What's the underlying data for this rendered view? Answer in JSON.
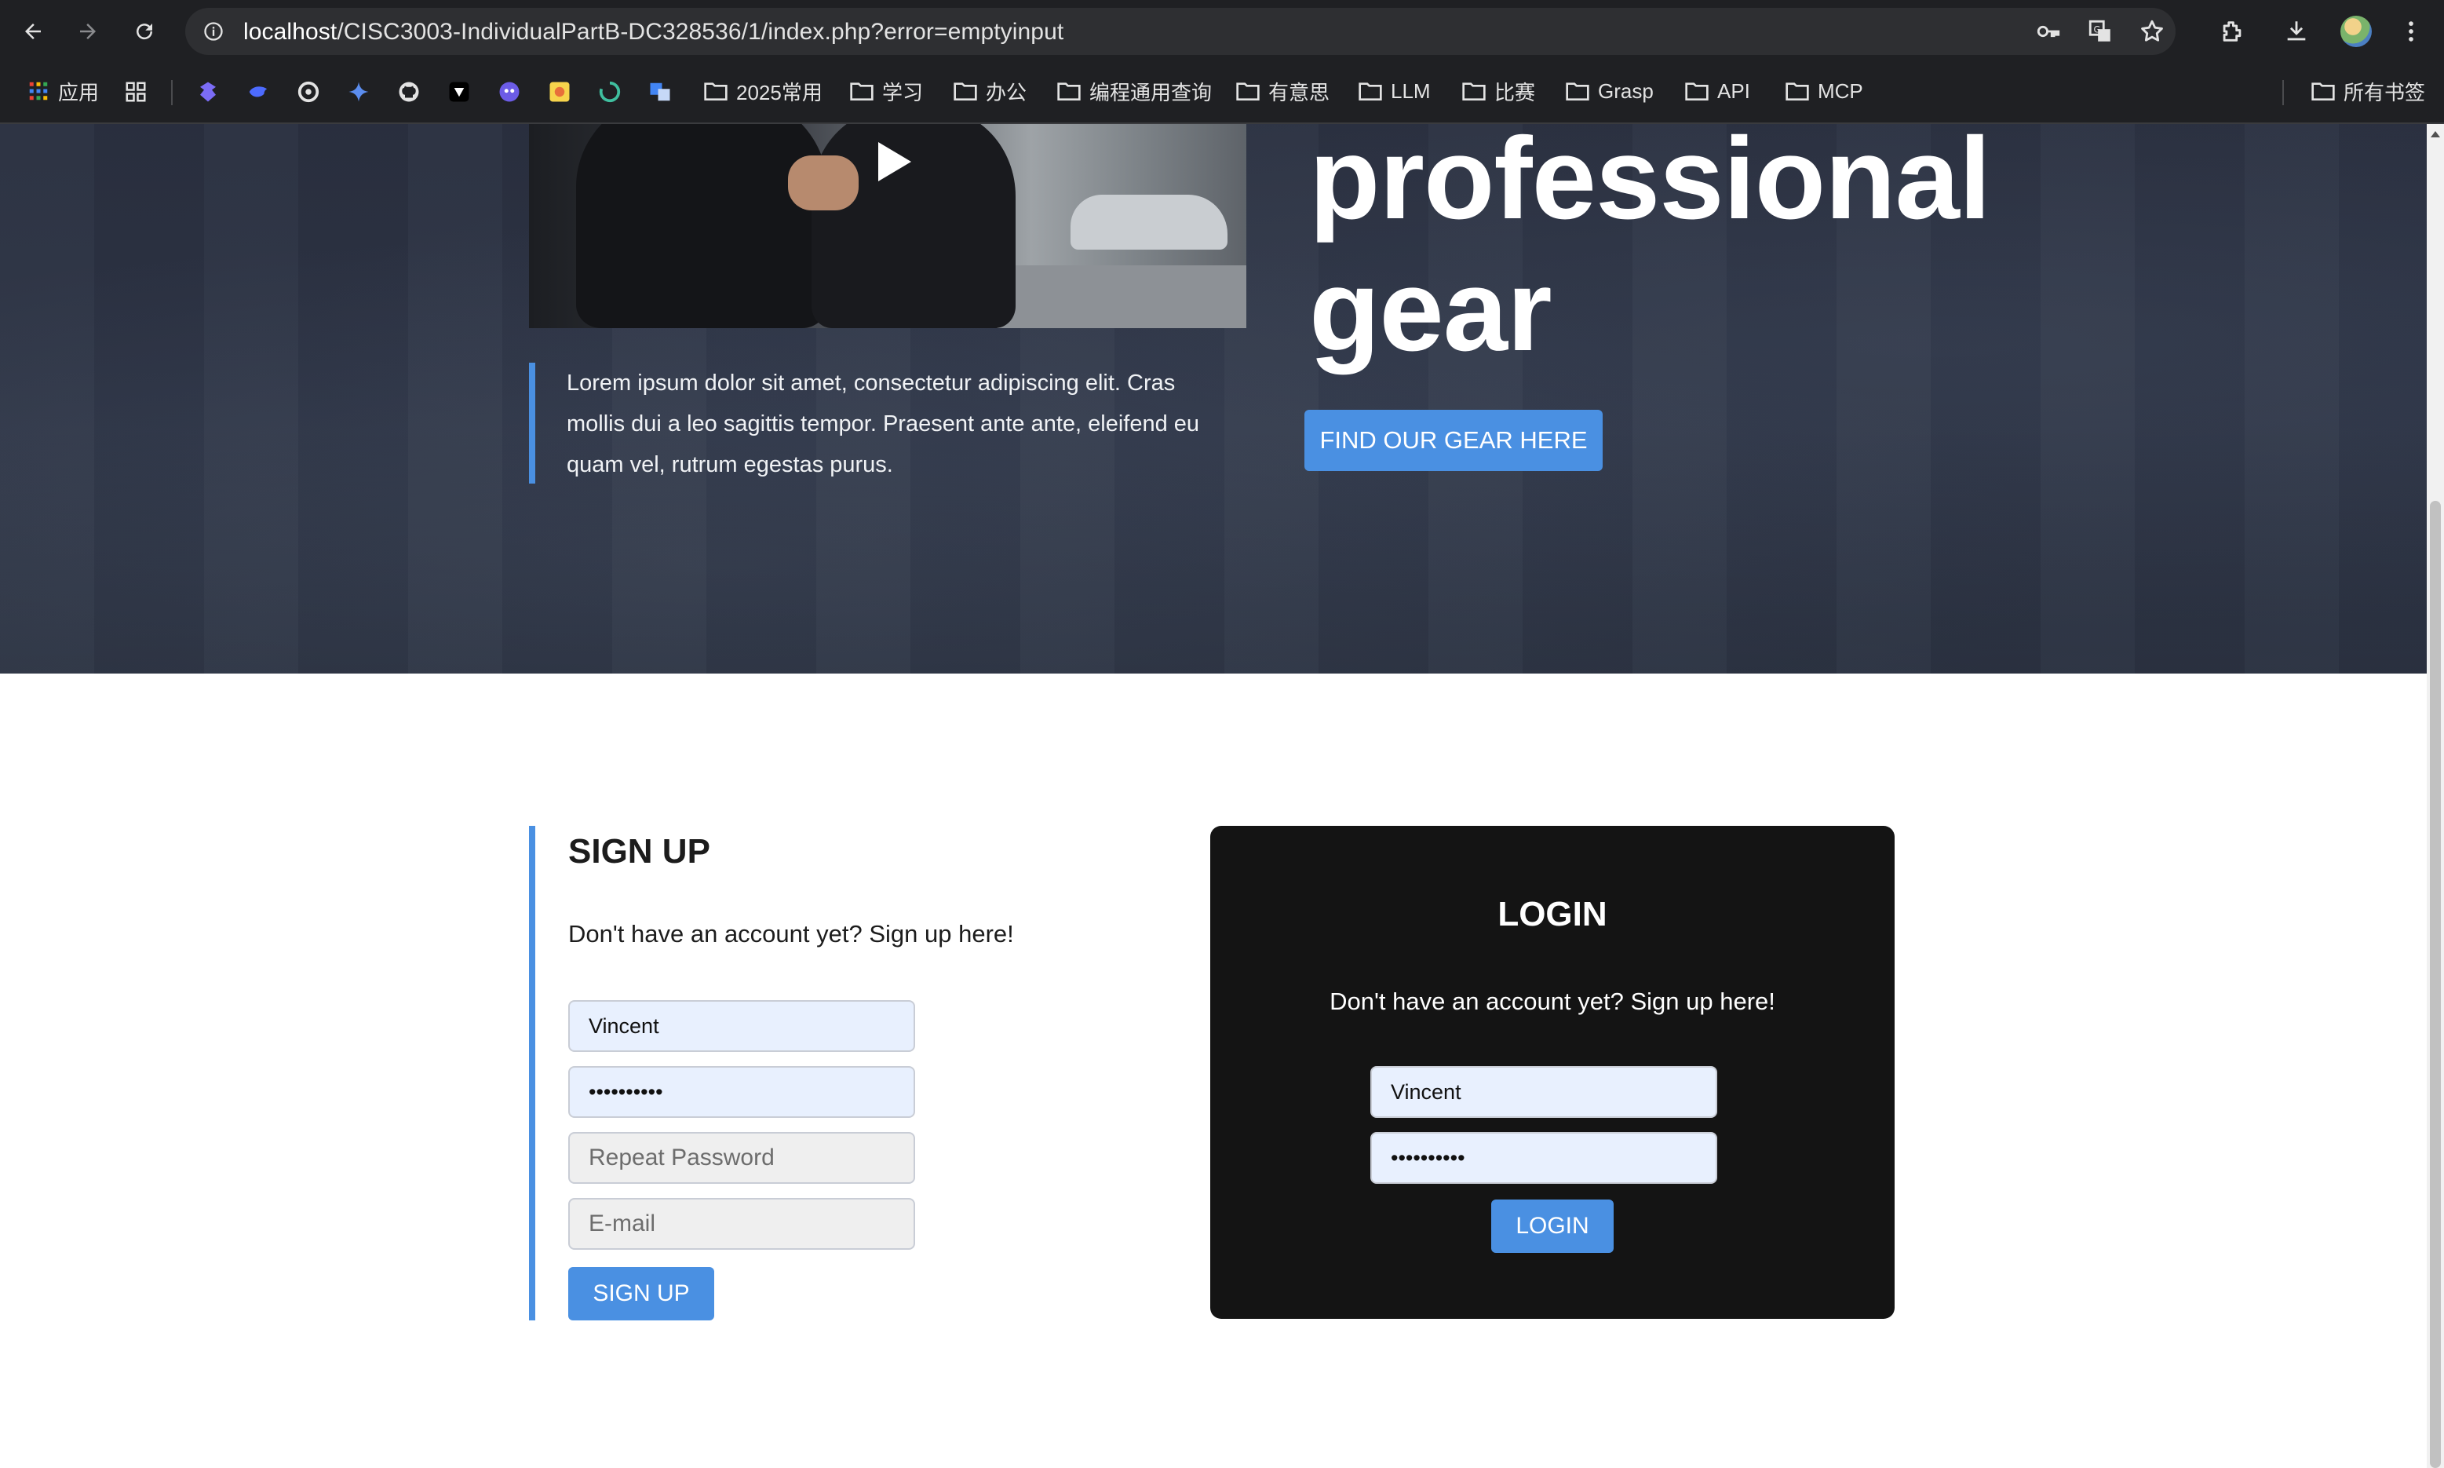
{
  "browser": {
    "url_host": "localhost",
    "url_path": "/CISC3003-IndividualPartB-DC328536/1/index.php?error=emptyinput",
    "icons": [
      "back-icon",
      "forward-icon",
      "reload-icon",
      "site-info-icon",
      "password-key-icon",
      "translate-icon",
      "bookmark-star-icon",
      "extensions-icon",
      "downloads-icon",
      "profile-avatar",
      "menu-icon"
    ]
  },
  "bookmarks": {
    "apps_label": "应用",
    "folders": [
      "2025常用",
      "学习",
      "办公",
      "编程通用查询",
      "有意思",
      "LLM",
      "比赛",
      "Grasp",
      "API",
      "MCP"
    ],
    "all_bookmarks_label": "所有书签"
  },
  "hero": {
    "title": "professional\ngear",
    "quote": "Lorem ipsum dolor sit amet, consectetur adipiscing elit. Cras mollis dui a leo sagittis tempor. Praesent ante ante, eleifend eu quam vel, rutrum egestas purus.",
    "cta_label": "FIND OUR GEAR HERE"
  },
  "signup": {
    "title": "SIGN UP",
    "subtitle": "Don't have an account yet? Sign up here!",
    "username_value": "Vincent",
    "password_value": "••••••••••",
    "repeat_password_placeholder": "Repeat Password",
    "email_placeholder": "E-mail",
    "button_label": "SIGN UP"
  },
  "login": {
    "title": "LOGIN",
    "subtitle": "Don't have an account yet? Sign up here!",
    "username_value": "Vincent",
    "password_value": "••••••••••",
    "button_label": "LOGIN"
  },
  "colors": {
    "accent": "#4a90e2",
    "hero_bg": "#2c3344",
    "login_bg": "#141414",
    "autofill_bg": "#e8f0fe"
  }
}
